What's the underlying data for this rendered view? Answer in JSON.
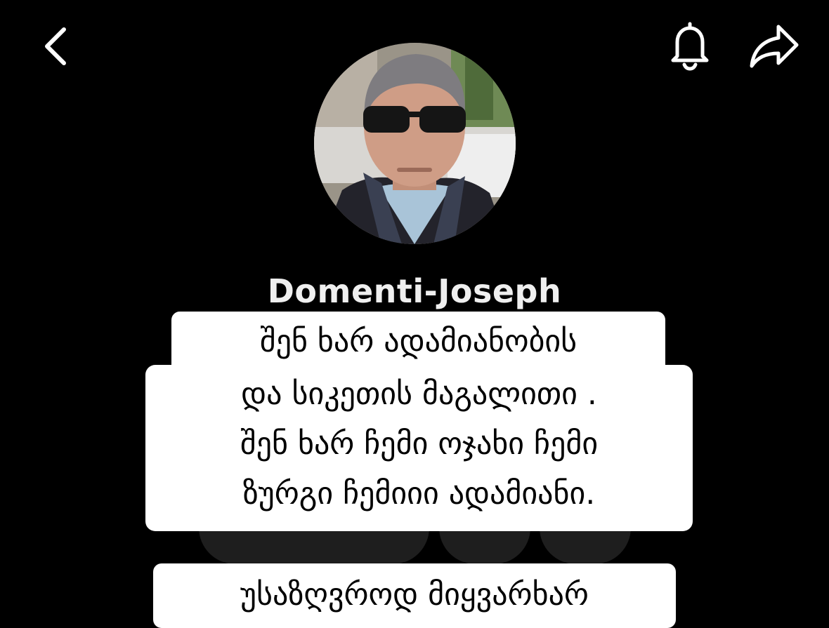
{
  "profile": {
    "name": "Domenti-Joseph"
  },
  "caption": {
    "lines": [
      "შენ ხარ ადამიანობის",
      "და სიკეთის მაგალითი .",
      "შენ ხარ ჩემი ოჯახი ჩემი",
      "ზურგი ჩემიიი ადამიანი."
    ],
    "secondary": "უსაზღვროდ მიყვარხარ"
  },
  "icons": {
    "back": "chevron-left-icon",
    "notifications": "bell-icon",
    "share": "share-arrow-icon"
  },
  "colors": {
    "background": "#000000",
    "name_text": "#efefef",
    "caption_bg": "#ffffff",
    "caption_text": "#000000",
    "pill_bg": "#1e1e1e"
  }
}
